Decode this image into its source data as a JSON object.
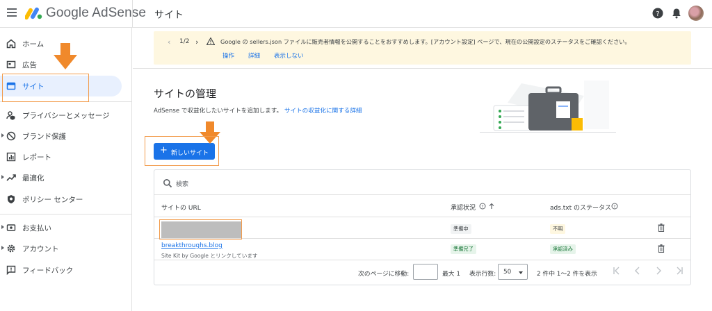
{
  "app": {
    "name": "Google AdSense",
    "page_title": "サイト"
  },
  "sidebar": {
    "items": [
      {
        "label": "ホーム",
        "icon": "home-icon"
      },
      {
        "label": "広告",
        "icon": "ads-icon"
      },
      {
        "label": "サイト",
        "icon": "sites-icon",
        "active": true
      },
      {
        "label": "プライバシーとメッセージ",
        "icon": "privacy-icon"
      },
      {
        "label": "ブランド保護",
        "icon": "block-icon"
      },
      {
        "label": "レポート",
        "icon": "report-icon"
      },
      {
        "label": "最適化",
        "icon": "trending-icon"
      },
      {
        "label": "ポリシー センター",
        "icon": "policy-icon"
      },
      {
        "label": "お支払い",
        "icon": "payments-icon"
      },
      {
        "label": "アカウント",
        "icon": "gear-icon"
      },
      {
        "label": "フィードバック",
        "icon": "feedback-icon"
      }
    ]
  },
  "banner": {
    "pager": "1/2",
    "message": "Google の sellers.json ファイルに販売者情報を公開することをおすすめします。[アカウント設定] ページで、現在の公開設定のステータスをご確認ください。",
    "actions": [
      "操作",
      "詳細",
      "表示しない"
    ]
  },
  "main": {
    "heading": "サイトの管理",
    "description": "AdSense で収益化したいサイトを追加します。",
    "description_link": "サイトの収益化に関する詳細",
    "new_site_button": "新しいサイト"
  },
  "table": {
    "search_placeholder": "検索",
    "headers": {
      "url": "サイトの URL",
      "status": "承認状況",
      "ads_txt": "ads.txt のステータス"
    },
    "rows": [
      {
        "url": "",
        "redacted": true,
        "status": "準備中",
        "ads_txt": "不明"
      },
      {
        "url": "breakthroughs.blog",
        "sub": "Site Kit by Google とリンクしています",
        "status": "準備完了",
        "ads_txt": "承認済み"
      }
    ],
    "footer": {
      "goto_label": "次のページに移動:",
      "max_label": "最大 1",
      "rows_label": "表示行数:",
      "rows_value": "50",
      "range_label": "2 件中 1〜2 件を表示"
    }
  },
  "colors": {
    "accent": "#1a73e8",
    "highlight": "#f29b4b",
    "banner_bg": "#fef7e0"
  }
}
